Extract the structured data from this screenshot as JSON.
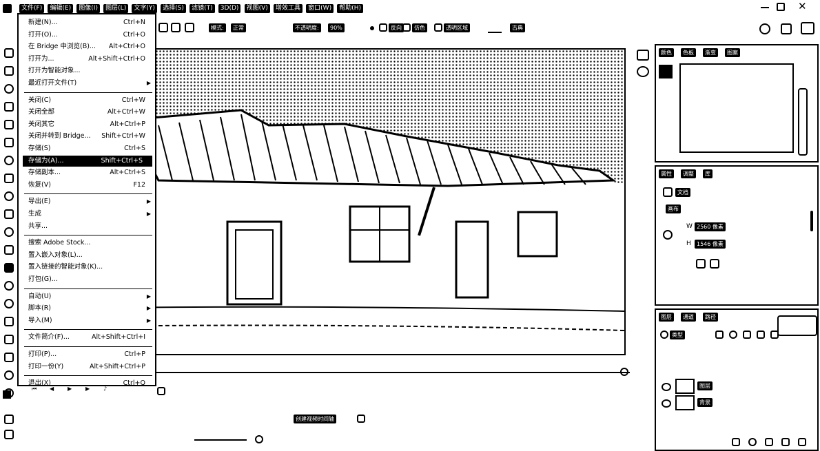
{
  "menubar": {
    "app_icon": "ps-logo-icon",
    "items": [
      "文件(F)",
      "编辑(E)",
      "图像(I)",
      "图层(L)",
      "文字(Y)",
      "选择(S)",
      "滤镜(T)",
      "3D(D)",
      "视图(V)",
      "增效工具",
      "窗口(W)",
      "帮助(H)"
    ],
    "window_controls": [
      "minimize-icon",
      "restore-icon",
      "close-icon"
    ]
  },
  "options_bar": {
    "mode_label": "模式:",
    "mode_value": "正常",
    "opacity_label": "不透明度:",
    "opacity_value": "90%",
    "reverse_label": "反向",
    "dither_label": "仿色",
    "transparency_label": "透明区域",
    "align_icon": "align-icon",
    "style_label": "古典"
  },
  "file_menu": {
    "items": [
      {
        "label": "新建(N)...",
        "shortcut": "Ctrl+N"
      },
      {
        "label": "打开(O)...",
        "shortcut": "Ctrl+O"
      },
      {
        "label": "在 Bridge 中浏览(B)...",
        "shortcut": "Alt+Ctrl+O"
      },
      {
        "label": "打开为...",
        "shortcut": "Alt+Shift+Ctrl+O"
      },
      {
        "label": "打开为智能对象...",
        "shortcut": ""
      },
      {
        "label": "最近打开文件(T)",
        "shortcut": "",
        "submenu": true
      },
      {
        "sep": true
      },
      {
        "label": "关闭(C)",
        "shortcut": "Ctrl+W"
      },
      {
        "label": "关闭全部",
        "shortcut": "Alt+Ctrl+W"
      },
      {
        "label": "关闭其它",
        "shortcut": "Alt+Ctrl+P"
      },
      {
        "label": "关闭并转到 Bridge...",
        "shortcut": "Shift+Ctrl+W"
      },
      {
        "label": "存储(S)",
        "shortcut": "Ctrl+S"
      },
      {
        "label": "存储为(A)...",
        "shortcut": "Shift+Ctrl+S",
        "highlight": true
      },
      {
        "label": "存储副本...",
        "shortcut": "Alt+Ctrl+S"
      },
      {
        "label": "恢复(V)",
        "shortcut": "F12"
      },
      {
        "sep": true
      },
      {
        "label": "导出(E)",
        "shortcut": "",
        "submenu": true
      },
      {
        "label": "生成",
        "shortcut": "",
        "submenu": true
      },
      {
        "label": "共享...",
        "shortcut": ""
      },
      {
        "sep": true
      },
      {
        "label": "搜索 Adobe Stock...",
        "shortcut": ""
      },
      {
        "label": "置入嵌入对象(L)...",
        "shortcut": ""
      },
      {
        "label": "置入链接的智能对象(K)...",
        "shortcut": ""
      },
      {
        "label": "打包(G)...",
        "shortcut": ""
      },
      {
        "sep": true
      },
      {
        "label": "自动(U)",
        "shortcut": "",
        "submenu": true
      },
      {
        "label": "脚本(R)",
        "shortcut": "",
        "submenu": true
      },
      {
        "label": "导入(M)",
        "shortcut": "",
        "submenu": true
      },
      {
        "sep": true
      },
      {
        "label": "文件简介(F)...",
        "shortcut": "Alt+Shift+Ctrl+I"
      },
      {
        "sep": true
      },
      {
        "label": "打印(P)...",
        "shortcut": "Ctrl+P"
      },
      {
        "label": "打印一份(Y)",
        "shortcut": "Alt+Shift+Ctrl+P"
      },
      {
        "sep": true
      },
      {
        "label": "退出(X)",
        "shortcut": "Ctrl+Q"
      }
    ]
  },
  "canvas": {
    "image_subject": "house-sketch-image"
  },
  "timeline": {
    "create_video_timeline_label": "创建视频时间轴"
  },
  "right_panels": {
    "navigator_tabs": [
      "颜色",
      "色板",
      "渐变",
      "图案"
    ],
    "properties_tabs": [
      "属性",
      "调整",
      "库"
    ],
    "doc_label": "文档",
    "canvas_label": "画布",
    "width_label": "W",
    "width_value": "2560 像素",
    "height_label": "H",
    "height_value": "1546 像素",
    "layers_tabs": [
      "图层",
      "通道",
      "路径"
    ],
    "kind_label": "类型",
    "layer_names": [
      "图层",
      "背景"
    ],
    "tooltip_text": ""
  }
}
